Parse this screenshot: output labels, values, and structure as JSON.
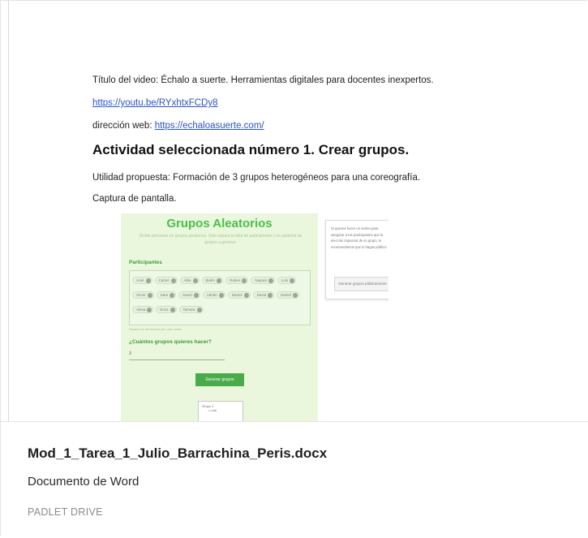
{
  "document": {
    "line1": "Título del video: Échalo a suerte. Herramientas digitales para docentes inexpertos.",
    "link_video": "https://youtu.be/RYxhtxFCDy8",
    "web_prefix": "dirección web: ",
    "web_link": "https://echaloasuerte.com/",
    "heading": "Actividad seleccionada número 1. Crear grupos.",
    "utility": "Utilidad propuesta: Formación de 3 grupos heterogéneos para una coreografía.",
    "capture_label": "Captura de pantalla."
  },
  "screenshot": {
    "title": "Grupos Aleatorios",
    "subtitle": "Divide personas en grupos aleatorios. Solo separa la lista de participantes y la cantidad de grupos a generar.",
    "participants_label": "Participantes",
    "participants": [
      "José",
      "Carlos",
      "Alba",
      "Belén",
      "Ruben",
      "Nayara",
      "Luis",
      "Víctor",
      "Sara",
      "David",
      "Adrián",
      "Daniel",
      "David",
      "Daniel",
      "Alexa",
      "Erica",
      "Tamara"
    ],
    "hint": "Separa los elementos por una coma.",
    "groups_question": "¿Cuántos grupos quieres hacer?",
    "groups_value": "3",
    "generate_button": "Generar grupos",
    "result_title": "Grupo 1",
    "result_item": "Luis",
    "side_text": "Si quieres hacer un sorteo para asegurar a tus participantes que la elección imparcial de su grupo, te recomendamos que lo hagas público.",
    "side_button": "Generar grupos públicamente"
  },
  "footer": {
    "file_name": "Mod_1_Tarea_1_Julio_Barrachina_Peris.docx",
    "file_type": "Documento de Word",
    "source": "PADLET DRIVE"
  },
  "colors": {
    "link": "#2b54c7",
    "app_green": "#4bbf4b",
    "app_background": "#eaf7dc"
  }
}
